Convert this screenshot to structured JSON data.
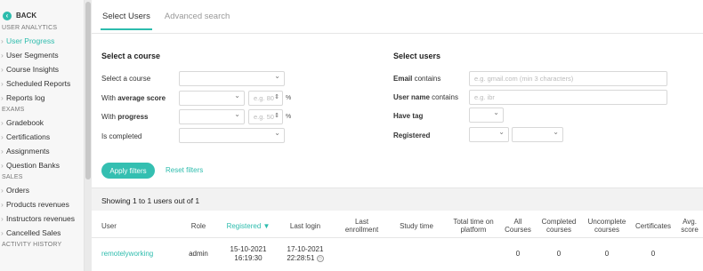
{
  "sidebar": {
    "back_label": "BACK",
    "sections": [
      {
        "title": "USER ANALYTICS",
        "items": [
          "User Progress",
          "User Segments",
          "Course Insights",
          "Scheduled Reports",
          "Reports log"
        ]
      },
      {
        "title": "EXAMS",
        "items": [
          "Gradebook",
          "Certifications",
          "Assignments",
          "Question Banks"
        ]
      },
      {
        "title": "SALES",
        "items": [
          "Orders",
          "Products revenues",
          "Instructors revenues",
          "Cancelled Sales"
        ]
      },
      {
        "title": "ACTIVITY HISTORY",
        "items": []
      }
    ],
    "active_item": "User Progress"
  },
  "tabs": [
    "Select Users",
    "Advanced search"
  ],
  "course_filter": {
    "title": "Select a course",
    "select_course_label": "Select a course",
    "avg_score_label_prefix": "With ",
    "avg_score_label_bold": "average score",
    "avg_score_placeholder": "e.g. 80",
    "progress_label_prefix": "With ",
    "progress_label_bold": "progress",
    "progress_placeholder": "e.g. 50",
    "percent": "%",
    "completed_label": "Is completed"
  },
  "user_filter": {
    "title": "Select users",
    "email_label_bold": "Email",
    "email_label_rest": " contains",
    "email_placeholder": "e.g. gmail.com (min 3 characters)",
    "username_label_bold": "User name",
    "username_label_rest": " contains",
    "username_placeholder": "e.g. ibr",
    "tag_label": "Have tag",
    "registered_label": "Registered"
  },
  "buttons": {
    "apply": "Apply filters",
    "reset": "Reset filters"
  },
  "summary": "Showing 1 to 1 users out of 1",
  "table": {
    "headers": {
      "user": "User",
      "role": "Role",
      "registered": "Registered ▼",
      "last_login": "Last login",
      "last_enrollment_1": "Last",
      "last_enrollment_2": "enrollment",
      "study_time": "Study time",
      "total_time_1": "Total time on",
      "total_time_2": "platform",
      "all_courses_1": "All",
      "all_courses_2": "Courses",
      "completed_1": "Completed",
      "completed_2": "courses",
      "uncomplete_1": "Uncomplete",
      "uncomplete_2": "courses",
      "certificates": "Certificates",
      "avg_score_1": "Avg.",
      "avg_score_2": "score"
    },
    "rows": [
      {
        "user": "remotelyworking",
        "role": "admin",
        "registered_date": "15-10-2021",
        "registered_time": "16:19:30",
        "last_login_date": "17-10-2021",
        "last_login_time": "22:28:51",
        "all_courses": "0",
        "completed": "0",
        "uncomplete": "0",
        "certificates": "0"
      }
    ]
  },
  "colors": {
    "accent": "#2dbcad"
  }
}
